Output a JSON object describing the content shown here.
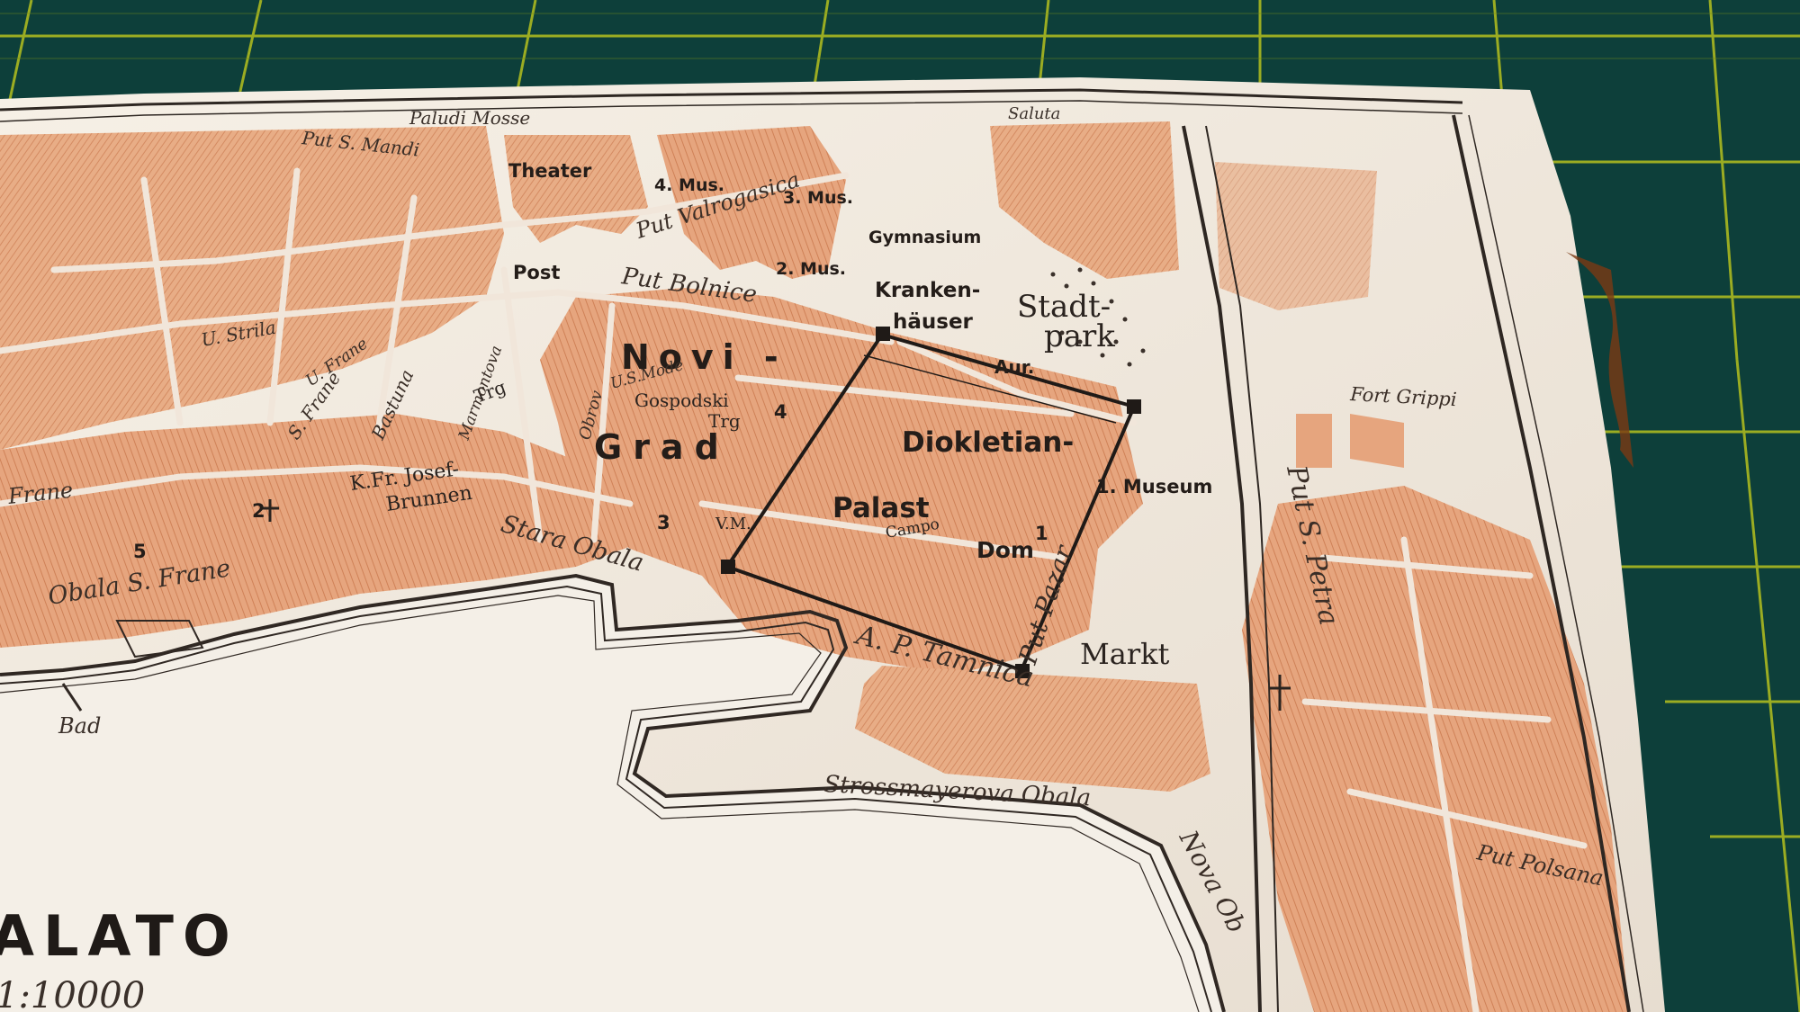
{
  "map": {
    "city_title": "ALATO",
    "scale": "1:10000",
    "frame_top_labels": [
      "Paludi Mosse",
      "Saluta"
    ],
    "districts": {
      "novi": "Novi -",
      "grad": "Grad",
      "diokletian": "Diokletian-",
      "palast": "Palast",
      "dom": "Dom",
      "stadtpark_1": "Stadt-",
      "stadtpark_2": "park"
    },
    "buildings": {
      "theater": "Theater",
      "mus4": "4. Mus.",
      "mus3": "3. Mus.",
      "gymnasium": "Gymnasium",
      "mus2": "2. Mus.",
      "kranken_1": "Kranken-",
      "kranken_2": "häuser",
      "post": "Post",
      "aur": "Aur.",
      "museum": "1. Museum",
      "markt": "Markt",
      "gospodski_1": "Gospodski",
      "gospodski_2": "Trg",
      "brunnen_1": "K.Fr. Josef-",
      "brunnen_2": "Brunnen",
      "bad": "Bad",
      "campo": "Campo",
      "trg": "Trg",
      "vm": "V.M."
    },
    "streets": {
      "put_s_mandi": "Put S. Mandi",
      "put_valrogasica": "Put Valrogasica",
      "put_bolnice": "Put Bolnice",
      "u_strila": "U. Strila",
      "u_frane": "U. Frane",
      "frane": "Frane",
      "s_frane": "S. Frane",
      "bastuna": "Bastuna",
      "marmontova": "Marmontova",
      "obala_s_frane": "Obala S. Frane",
      "stara_obala": "Stara  Obala",
      "put_tamnica": "A. P. Tamnica",
      "strossmayerova": "Strossmayerova Obala",
      "nova_obala": "Nova Ob",
      "put_s_petra": "Put S. Petra",
      "put_polsana": "Put Polsana",
      "fort_grippi": "Fort Grippi",
      "put_pazar": "Put Pazar",
      "obrov": "Obrov",
      "u_mode": "U.S.Mode"
    },
    "numbers": [
      "1",
      "2",
      "3",
      "4",
      "5"
    ],
    "colors": {
      "background_mat": "#0d3f3a",
      "grid_lines": "#b4c01e",
      "paper": "#f0e9de",
      "blocks": "#e3a47c",
      "block_edge": "#c97b55",
      "ink": "#2a231f",
      "sea": "#f3eee6",
      "paper_edge_stain": "#7a3a14"
    }
  }
}
